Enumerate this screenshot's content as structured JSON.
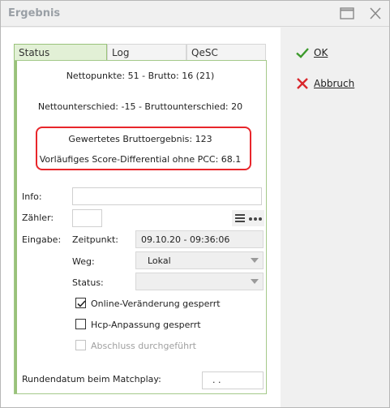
{
  "window": {
    "title": "Ergebnis"
  },
  "tabs": [
    {
      "label": "Status",
      "active": true
    },
    {
      "label": "Log",
      "active": false
    },
    {
      "label": "QeSC",
      "active": false
    }
  ],
  "status": {
    "line1": "Nettopunkte: 51 - Brutto: 16 (21)",
    "line2": "Nettounterschied: -15 - Bruttounterschied: 20",
    "line3": "Gewertetes Bruttoergebnis: 123",
    "line4": "Vorläufiges Score-Differential ohne PCC: 68.1"
  },
  "form": {
    "info_label": "Info:",
    "info_value": "",
    "zaehler_label": "Zähler:",
    "zaehler_value": "",
    "eingabe_label": "Eingabe:",
    "zeitpunkt_label": "Zeitpunkt:",
    "zeitpunkt_value": "09.10.20 - 09:36:06",
    "weg_label": "Weg:",
    "weg_value": "Lokal",
    "status_label": "Status:",
    "status_value": "",
    "online_label": "Online-Veränderung gesperrt",
    "online_checked": true,
    "hcp_label": "Hcp-Anpassung gesperrt",
    "hcp_checked": false,
    "abschluss_label": "Abschluss durchgeführt",
    "abschluss_checked": false,
    "runden_label": "Rundendatum beim Matchplay:",
    "runden_value": ". ."
  },
  "actions": {
    "ok_label": "OK",
    "cancel_label": "Abbruch"
  },
  "colors": {
    "accent_green": "#9ac27a",
    "highlight_red": "#e8262b",
    "ok_green": "#3c9a2c",
    "cancel_red": "#d9262b"
  }
}
